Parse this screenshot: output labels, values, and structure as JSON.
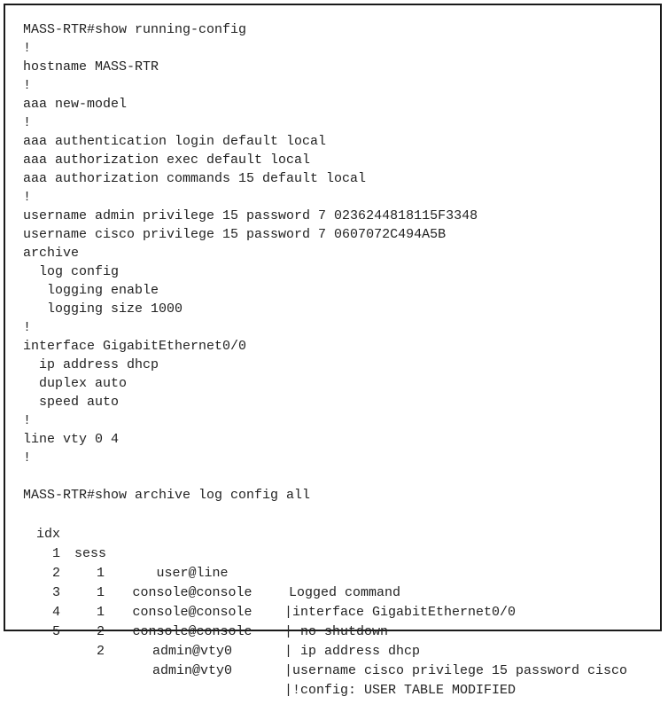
{
  "running_config": {
    "lines": [
      "MASS-RTR#show running-config",
      "!",
      "hostname MASS-RTR",
      "!",
      "aaa new-model",
      "!",
      "aaa authentication login default local",
      "aaa authorization exec default local",
      "aaa authorization commands 15 default local",
      "!",
      "username admin privilege 15 password 7 0236244818115F3348",
      "username cisco privilege 15 password 7 0607072C494A5B",
      "archive",
      "  log config",
      "   logging enable",
      "   logging size 1000",
      "!",
      "interface GigabitEthernet0/0",
      "  ip address dhcp",
      "  duplex auto",
      "  speed auto",
      "!",
      "line vty 0 4",
      "!",
      "",
      "MASS-RTR#show archive log config all"
    ]
  },
  "archive_log": {
    "headers": {
      "idx": "idx",
      "sess": "sess",
      "user": "user@line",
      "cmd": "Logged command"
    },
    "rows": [
      {
        "idx": "1",
        "sess": "1",
        "user": "console@console",
        "cmd": "|interface GigabitEthernet0/0"
      },
      {
        "idx": "2",
        "sess": "1",
        "user": "console@console",
        "cmd": "| no shutdown"
      },
      {
        "idx": "3",
        "sess": "1",
        "user": "console@console",
        "cmd": "| ip address dhcp"
      },
      {
        "idx": "4",
        "sess": "2",
        "user": "admin@vty0",
        "cmd": "|username cisco privilege 15 password cisco"
      },
      {
        "idx": "5",
        "sess": "2",
        "user": "admin@vty0",
        "cmd": "|!config: USER TABLE MODIFIED"
      }
    ]
  }
}
